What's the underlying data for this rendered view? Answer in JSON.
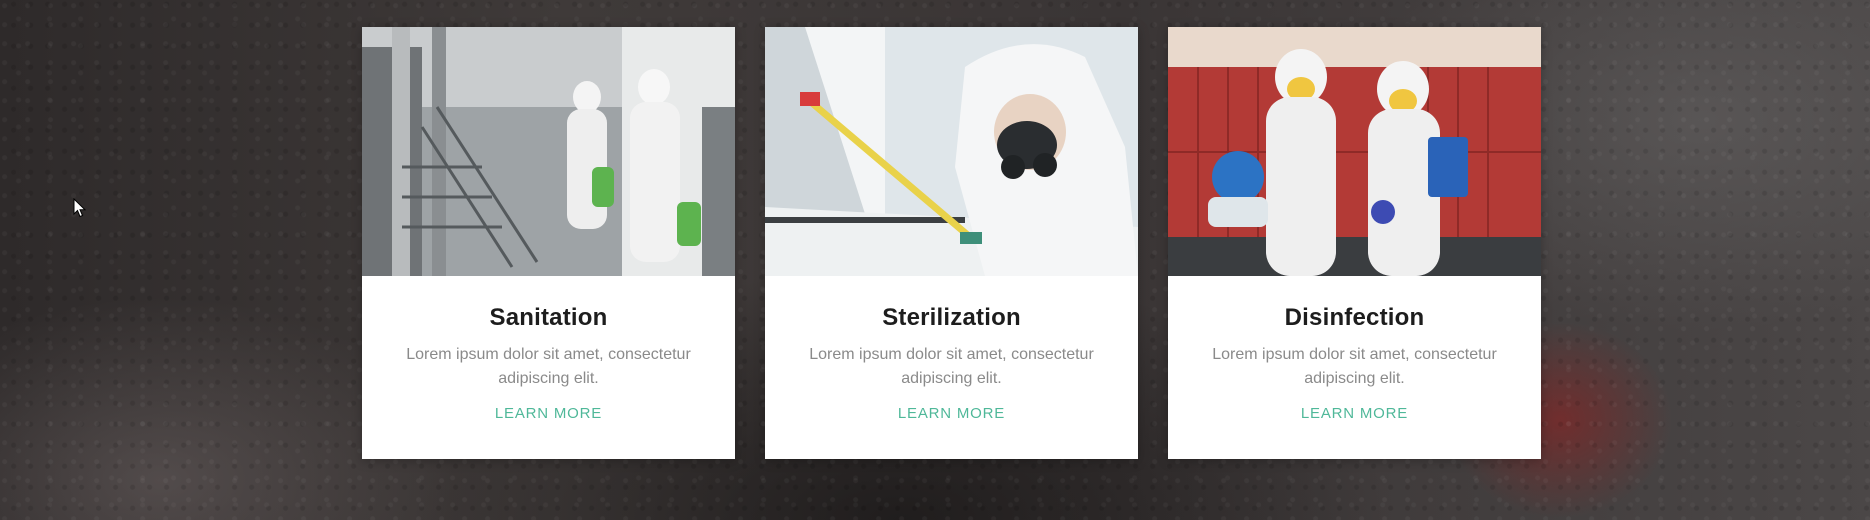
{
  "cards": [
    {
      "image_icon": "worker-spraying-photo",
      "title": "Sanitation",
      "description": "Lorem ipsum dolor sit amet, consectetur adipiscing elit.",
      "link_label": "LEARN MORE"
    },
    {
      "image_icon": "worker-respirator-photo",
      "title": "Sterilization",
      "description": "Lorem ipsum dolor sit amet, consectetur adipiscing elit.",
      "link_label": "LEARN MORE"
    },
    {
      "image_icon": "two-workers-photo",
      "title": "Disinfection",
      "description": "Lorem ipsum dolor sit amet, consectetur adipiscing elit.",
      "link_label": "LEARN MORE"
    }
  ],
  "colors": {
    "link_accent": "#4fb899",
    "title_text": "#1d1d1d",
    "body_text": "#8a8a8a",
    "card_background": "#ffffff"
  }
}
